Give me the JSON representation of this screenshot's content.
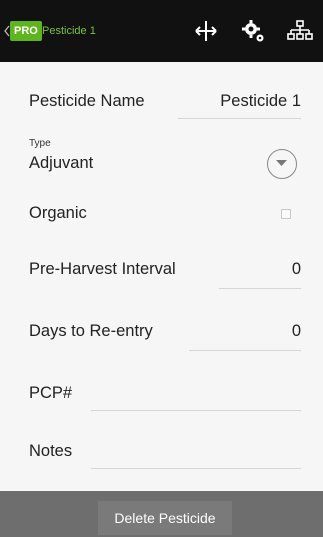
{
  "header": {
    "pro_badge": "PRO",
    "title": "Pesticide 1",
    "icons": [
      "move-icon",
      "settings-gears-icon",
      "hierarchy-icon"
    ]
  },
  "form": {
    "pesticide_name": {
      "label": "Pesticide Name",
      "value": "Pesticide 1"
    },
    "type": {
      "caption": "Type",
      "value": "Adjuvant"
    },
    "organic": {
      "label": "Organic",
      "checked": false
    },
    "pre_harvest_interval": {
      "label": "Pre-Harvest Interval",
      "value": "0"
    },
    "days_to_reentry": {
      "label": "Days to Re-entry",
      "value": "0"
    },
    "pcp": {
      "label": "PCP#",
      "value": ""
    },
    "notes": {
      "label": "Notes",
      "value": ""
    }
  },
  "footer": {
    "delete_label": "Delete Pesticide"
  },
  "colors": {
    "header_bg": "#111111",
    "accent_green": "#5fb51e",
    "footer_bg": "#6e6e6e"
  }
}
